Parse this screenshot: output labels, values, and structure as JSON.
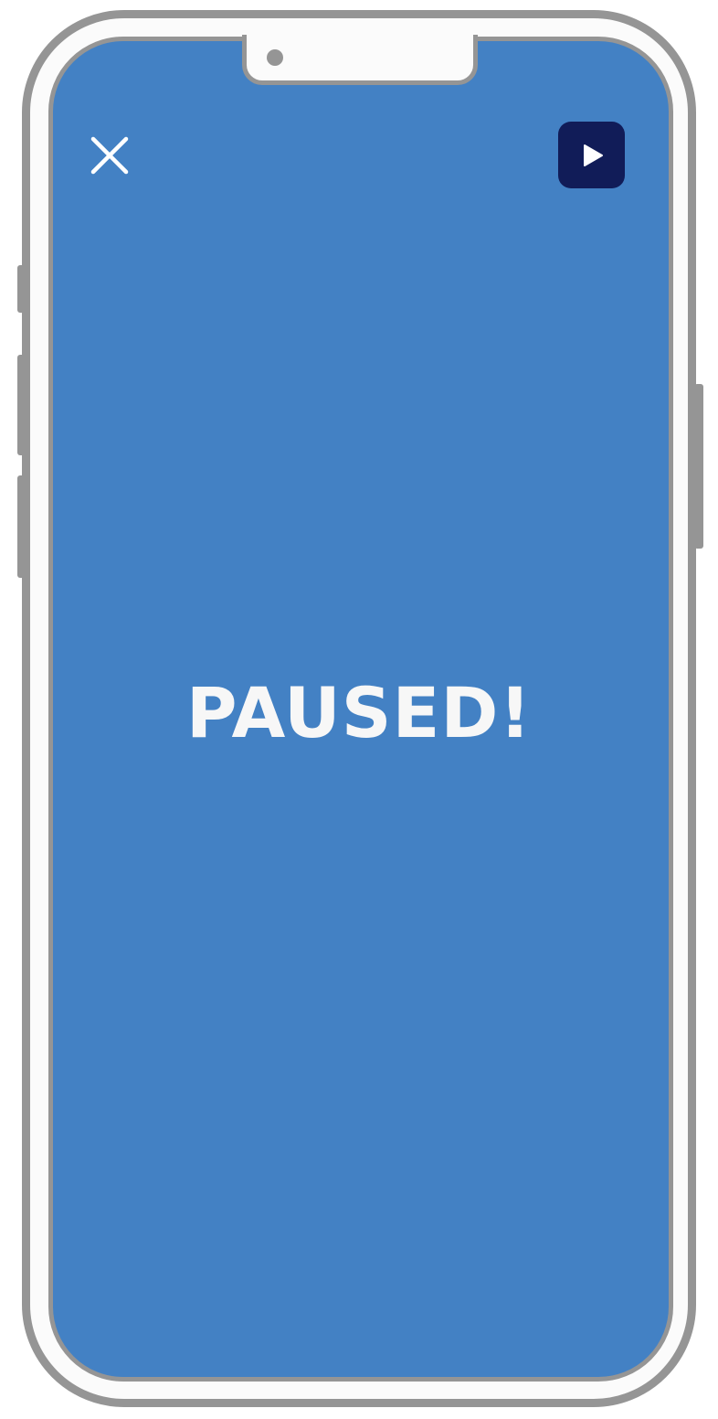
{
  "status": {
    "message": "PAUSED!"
  },
  "controls": {
    "close_icon": "close-icon",
    "play_icon": "play-icon"
  },
  "colors": {
    "screen_background": "#4381c4",
    "play_button_background": "#111c58",
    "frame": "#959595",
    "text": "#f7f7f7"
  }
}
